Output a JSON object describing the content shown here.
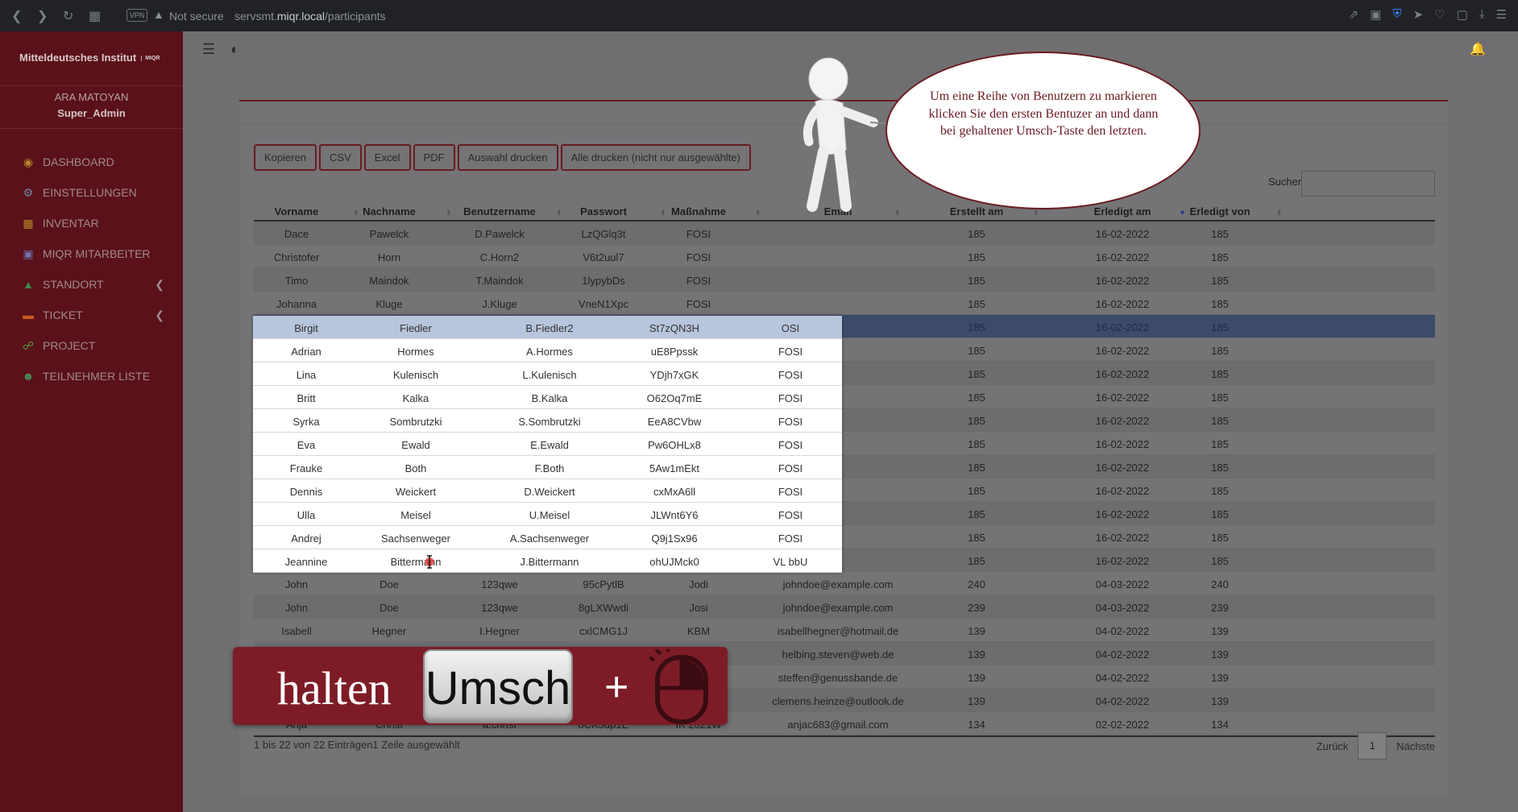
{
  "browser": {
    "vpn": "VPN",
    "security": "Not secure",
    "url_prefix": "servsmt.",
    "url_host": "miqr.local",
    "url_path": "/participants"
  },
  "sidebar": {
    "brand": "Mitteldeutsches Institut",
    "brand_logo": "MIQR",
    "username": "ARA MATOYAN",
    "role": "Super_Admin",
    "items": [
      {
        "label": "DASHBOARD",
        "icon": "dashboard-icon"
      },
      {
        "label": "EINSTELLUNGEN",
        "icon": "settings-icon"
      },
      {
        "label": "INVENTAR",
        "icon": "inventory-icon"
      },
      {
        "label": "MIQR MITARBEITER",
        "icon": "staff-icon"
      },
      {
        "label": "STANDORT",
        "icon": "location-icon"
      },
      {
        "label": "TICKET",
        "icon": "ticket-icon"
      },
      {
        "label": "PROJECT",
        "icon": "project-icon"
      },
      {
        "label": "TEILNEHMER LISTE",
        "icon": "participants-icon"
      }
    ]
  },
  "toolbar": {
    "buttons": [
      "Kopieren",
      "CSV",
      "Excel",
      "PDF",
      "Auswahl drucken",
      "Alle drucken (nicht nur ausgewählte)"
    ]
  },
  "search": {
    "label": "Suchen",
    "value": ""
  },
  "table": {
    "headers": [
      "Vorname",
      "Nachname",
      "Benutzername",
      "Passwort",
      "Maßnahme",
      "Email",
      "Erstellt am",
      "Erledigt am",
      "Erledigt von"
    ],
    "rows": [
      [
        "Dace",
        "Pawelck",
        "D.Pawelck",
        "LzQGlq3t",
        "FOSI",
        "",
        "185",
        "16-02-2022",
        "185"
      ],
      [
        "Christofer",
        "Horn",
        "C.Horn2",
        "V6t2uul7",
        "FOSI",
        "",
        "185",
        "16-02-2022",
        "185"
      ],
      [
        "Timo",
        "Maindok",
        "T.Maindok",
        "1lypybDs",
        "FOSI",
        "",
        "185",
        "16-02-2022",
        "185"
      ],
      [
        "Johanna",
        "Kluge",
        "J.Kluge",
        "VneN1Xpc",
        "FOSI",
        "",
        "185",
        "16-02-2022",
        "185"
      ],
      [
        "Birgit",
        "Fiedler",
        "B.Fiedler2",
        "St7zQN3H",
        "OSI",
        "",
        "185",
        "16-02-2022",
        "185"
      ],
      [
        "Adrian",
        "Hormes",
        "A.Hormes",
        "uE8Ppssk",
        "FOSI",
        "",
        "185",
        "16-02-2022",
        "185"
      ],
      [
        "Lina",
        "Kulenisch",
        "L.Kulenisch",
        "YDjh7xGK",
        "FOSI",
        "",
        "185",
        "16-02-2022",
        "185"
      ],
      [
        "Britt",
        "Kalka",
        "B.Kalka",
        "O62Oq7mE",
        "FOSI",
        "",
        "185",
        "16-02-2022",
        "185"
      ],
      [
        "Syrka",
        "Sombrutzki",
        "S.Sombrutzki",
        "EeA8CVbw",
        "FOSI",
        "",
        "185",
        "16-02-2022",
        "185"
      ],
      [
        "Eva",
        "Ewald",
        "E.Ewald",
        "Pw6OHLx8",
        "FOSI",
        "",
        "185",
        "16-02-2022",
        "185"
      ],
      [
        "Frauke",
        "Both",
        "F.Both",
        "5Aw1mEkt",
        "FOSI",
        "",
        "185",
        "16-02-2022",
        "185"
      ],
      [
        "Dennis",
        "Weickert",
        "D.Weickert",
        "cxMxA6ll",
        "FOSI",
        "",
        "185",
        "16-02-2022",
        "185"
      ],
      [
        "Ulla",
        "Meisel",
        "U.Meisel",
        "JLWnt6Y6",
        "FOSI",
        "",
        "185",
        "16-02-2022",
        "185"
      ],
      [
        "Andrej",
        "Sachsenweger",
        "A.Sachsenweger",
        "Q9j1Sx96",
        "FOSI",
        "",
        "185",
        "16-02-2022",
        "185"
      ],
      [
        "Jeannine",
        "Bittermann",
        "J.Bittermann",
        "ohUJMck0",
        "VL bbU",
        "",
        "185",
        "16-02-2022",
        "185"
      ],
      [
        "John",
        "Doe",
        "123qwe",
        "95cPytlB",
        "Jodi",
        "johndoe@example.com",
        "240",
        "04-03-2022",
        "240"
      ],
      [
        "John",
        "Doe",
        "123qwe",
        "8gLXWwdi",
        "Josi",
        "johndoe@example.com",
        "239",
        "04-03-2022",
        "239"
      ],
      [
        "Isabell",
        "Hegner",
        "I.Hegner",
        "cxlCMG1J",
        "KBM",
        "isabellhegner@hotmail.de",
        "139",
        "04-02-2022",
        "139"
      ],
      [
        "",
        "",
        "",
        "",
        "KBM",
        "helbing.steven@web.de",
        "139",
        "04-02-2022",
        "139"
      ],
      [
        "",
        "",
        "",
        "",
        "KBM",
        "steffen@genussbande.de",
        "139",
        "04-02-2022",
        "139"
      ],
      [
        "",
        "",
        "",
        "",
        "KBM",
        "clemens.heinze@outlook.de",
        "139",
        "04-02-2022",
        "139"
      ],
      [
        "Anja",
        "Christ",
        "a.christ",
        "oCK5dp1E",
        "IK 2021W",
        "anjac683@gmail.com",
        "134",
        "02-02-2022",
        "134"
      ]
    ],
    "selected_row": 4
  },
  "popup_rows_range": [
    4,
    14
  ],
  "footer": {
    "info": "1 bis 22 von 22 Einträgen1 Zeile ausgewählt",
    "prev": "Zurück",
    "page": "1",
    "next": "Nächste"
  },
  "tutorial": {
    "bubble": "Um eine Reihe von Benutzern zu markieren klicken Sie den ersten Bentuzer an und dann bei gehaltener Umsch-Taste den letzten.",
    "banner_word": "halten",
    "key_label": "Umsch",
    "plus": "+"
  },
  "colors": {
    "brand": "#6b1b22",
    "sidebar": "#5a1119",
    "selected_row": "#b7c5dd"
  }
}
